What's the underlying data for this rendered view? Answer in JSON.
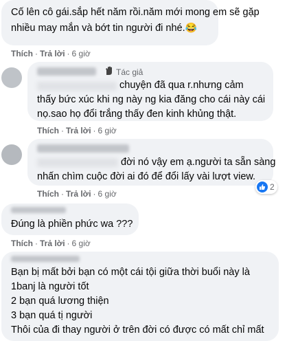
{
  "comments": [
    {
      "lines": [
        "Cố lên cô gái.sắp hết năm rồi.năm mới mong em sẽ gặp",
        "nhiều may mắn và bớt tin người đi nhé."
      ],
      "emoji": "😂",
      "like": "Thích",
      "reply": "Trả lời",
      "time": "6 giờ"
    },
    {
      "author_badge": "Tác giả",
      "lines": [
        "chuyện đã qua r.nhưng cảm",
        "thấy bức xúc khi ng này ng kia đăng cho cái này cái",
        "nọ.sao họ đổi trắng thấy đen kinh khủng thật."
      ],
      "like": "Thích",
      "reply": "Trả lời",
      "time": "6 giờ"
    },
    {
      "lines": [
        "đời nó vậy em ạ.người ta sẵn sàng",
        "nhấn chìm cuộc đời ai đó để đổi lấy vài lượt view."
      ],
      "reaction_count": "2",
      "like": "Thích",
      "reply": "Trả lời",
      "time": "6 giờ"
    },
    {
      "lines": [
        "Đúng là phiền phức wa ???"
      ],
      "like": "Thích",
      "reply": "Trả lời",
      "time": "6 giờ"
    },
    {
      "lines": [
        "Bạn bị mất bởi bạn có một cái tội giữa thời buổi này là",
        "1banj là người tốt",
        "2 bạn quá lương thiện",
        "3 bạn quá tị người",
        "Thôi của đi thay người ở trên đời có được có mất chỉ mất"
      ]
    }
  ],
  "colors": {
    "bubble": "#f0f2f5",
    "meta": "#65676b",
    "like_blue": "#1877f2"
  },
  "icons": [
    "laughing-emoji-icon",
    "author-badge-icon",
    "like-reaction-icon"
  ]
}
